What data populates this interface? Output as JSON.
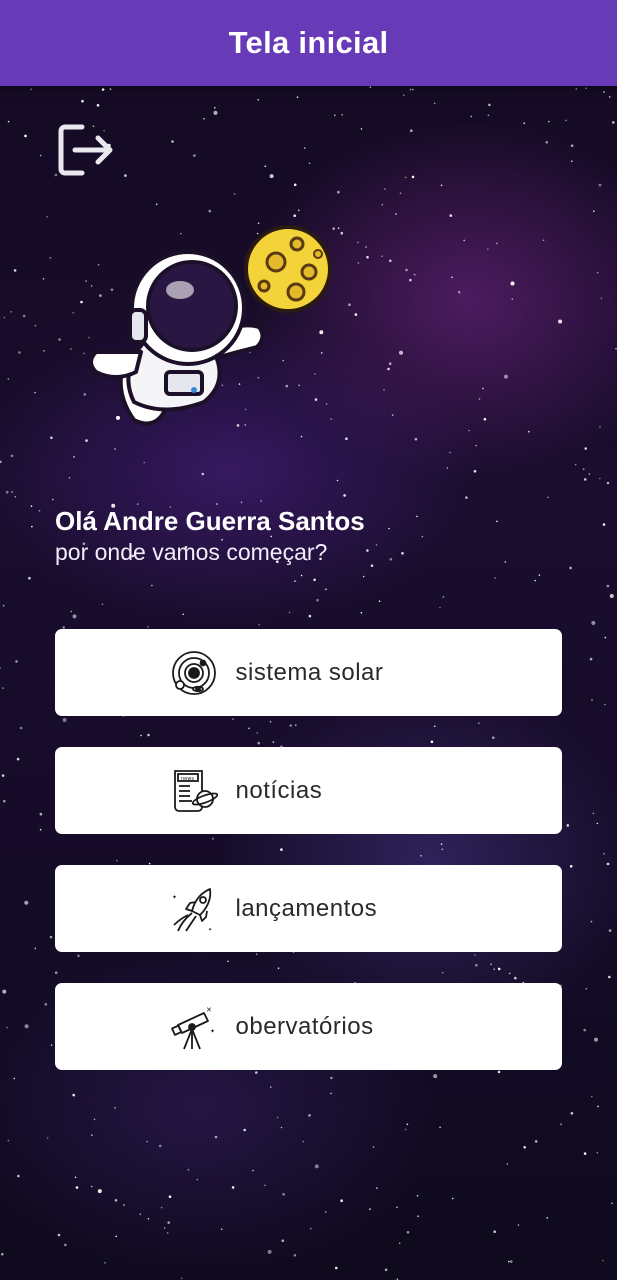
{
  "app_bar": {
    "title": "Tela inicial"
  },
  "greeting": {
    "name": "Olá Andre Guerra Santos",
    "subtitle": "por onde vamos começar?"
  },
  "menu": [
    {
      "label": "sistema solar",
      "icon": "solar-system-icon"
    },
    {
      "label": "notícias",
      "icon": "news-icon"
    },
    {
      "label": "lançamentos",
      "icon": "rocket-icon"
    },
    {
      "label": "obervatórios",
      "icon": "telescope-icon"
    }
  ],
  "colors": {
    "app_bar": "#673ab7",
    "background": "#1a0d2e",
    "button": "#ffffff"
  }
}
